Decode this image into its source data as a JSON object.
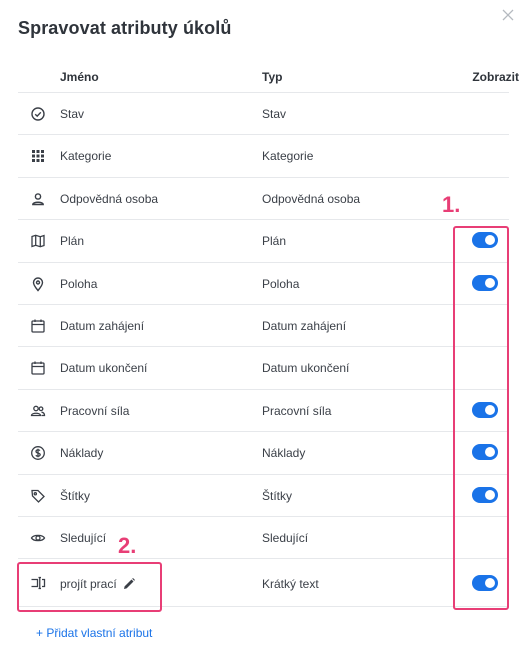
{
  "dialog": {
    "title": "Spravovat atributy úkolů",
    "close_icon": "close-icon"
  },
  "table": {
    "headers": {
      "name": "Jméno",
      "type": "Typ",
      "show": "Zobrazit"
    },
    "rows": [
      {
        "icon": "check-circle-icon",
        "name": "Stav",
        "type": "Stav",
        "toggle": null
      },
      {
        "icon": "grid-icon",
        "name": "Kategorie",
        "type": "Kategorie",
        "toggle": null
      },
      {
        "icon": "person-icon",
        "name": "Odpovědná osoba",
        "type": "Odpovědná osoba",
        "toggle": null
      },
      {
        "icon": "map-icon",
        "name": "Plán",
        "type": "Plán",
        "toggle": true
      },
      {
        "icon": "location-pin-icon",
        "name": "Poloha",
        "type": "Poloha",
        "toggle": true
      },
      {
        "icon": "calendar-icon",
        "name": "Datum zahájení",
        "type": "Datum zahájení",
        "toggle": null
      },
      {
        "icon": "calendar-icon",
        "name": "Datum ukončení",
        "type": "Datum ukončení",
        "toggle": null
      },
      {
        "icon": "people-icon",
        "name": "Pracovní síla",
        "type": "Pracovní síla",
        "toggle": true
      },
      {
        "icon": "dollar-circle-icon",
        "name": "Náklady",
        "type": "Náklady",
        "toggle": true
      },
      {
        "icon": "tag-icon",
        "name": "Štítky",
        "type": "Štítky",
        "toggle": true
      },
      {
        "icon": "eye-icon",
        "name": "Sledující",
        "type": "Sledující",
        "toggle": null
      },
      {
        "icon": "text-field-icon",
        "name": "projít prací",
        "type": "Krátký text",
        "toggle": true,
        "editable": true
      }
    ]
  },
  "add_attribute_label": "+ Přidat vlastní atribut",
  "annotations": {
    "label_1": "1.",
    "label_2": "2.",
    "color": "#e83e76"
  },
  "colors": {
    "accent": "#1a73e8",
    "text": "#3a3f47",
    "divider": "#e6e8eb"
  }
}
